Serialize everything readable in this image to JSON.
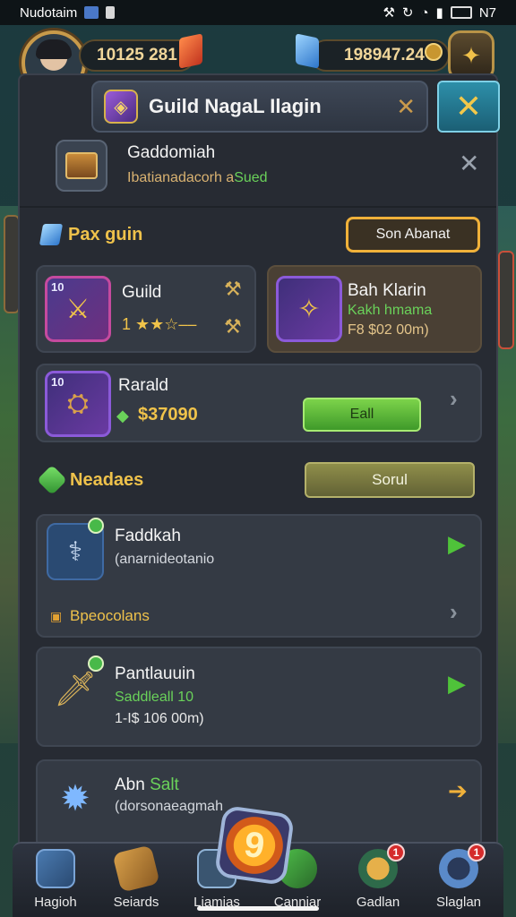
{
  "status_bar": {
    "left_text": "Nudotaim",
    "right_text": "N7",
    "icons": [
      "app-icon",
      "lock-icon",
      "alarm-icon",
      "sync-icon",
      "wifi-icon",
      "signal-icon",
      "battery-icon"
    ]
  },
  "resources": {
    "gold_amount": "10125 281",
    "gems_amount": "198947.24"
  },
  "panel": {
    "title": "Guild NagaL Ilagin",
    "info_title": "Gaddomiah",
    "info_sub_main": "Ibatianadacorh a",
    "info_sub_highlight": "Sued"
  },
  "section1": {
    "label": "Pax guin",
    "action_button": "Son Abanat",
    "cards": [
      {
        "level": "10",
        "title": "Guild",
        "sub": "1 ★★☆‒‒"
      },
      {
        "title": "Bah Klarin",
        "sub_green": "Kakh hmama",
        "sub_gold": "F8 $02 00m)"
      },
      {
        "level": "10",
        "title": "Rarald",
        "price": "$37090",
        "button": "Eall"
      }
    ]
  },
  "section2": {
    "label": "Neadaes",
    "action_button": "Sorul",
    "items": [
      {
        "title": "Faddkah",
        "sub": "(anarnideotanio",
        "footer": "Bpeocolans"
      },
      {
        "title": "Pantlauuin",
        "sub_green": "Saddleall 10",
        "sub_white": "1-I$ 106 00m)"
      },
      {
        "title": "Abn",
        "title_green": "Salt",
        "sub": "(dorsonaeagmah"
      }
    ]
  },
  "bottom_nav": [
    {
      "label": "Hagioh"
    },
    {
      "label": "Seiards"
    },
    {
      "label": "Liamias"
    },
    {
      "label": "Canniar"
    },
    {
      "label": "Gadlan",
      "badge": "1"
    },
    {
      "label": "Slaglan",
      "badge": "1"
    }
  ],
  "center_badge": "9",
  "colors": {
    "accent_gold": "#efc24b",
    "accent_green": "#6ad25a",
    "panel_bg": "#272b33",
    "close_blue": "#2d8fa9"
  }
}
